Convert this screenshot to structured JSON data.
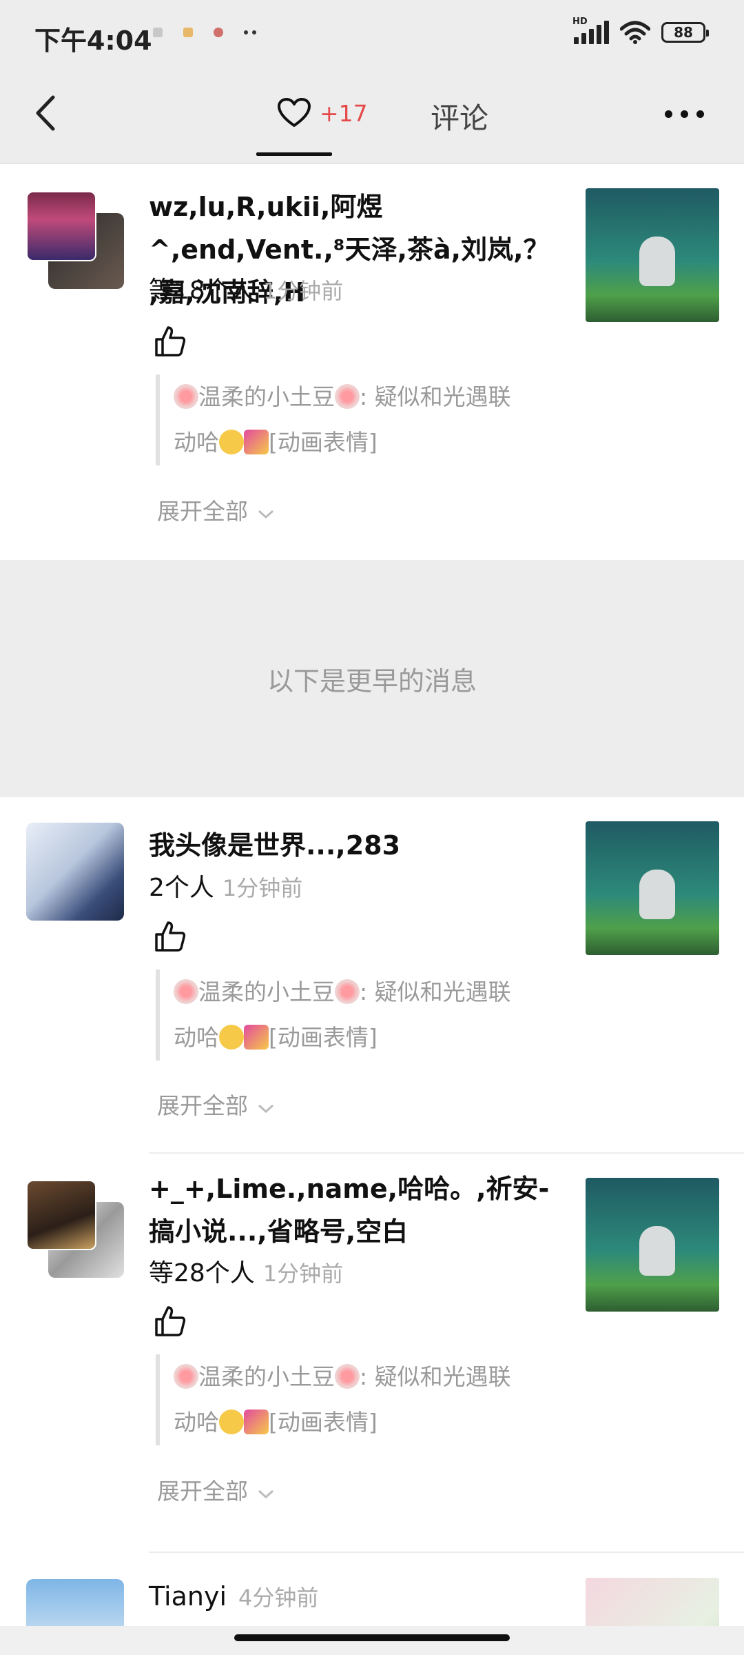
{
  "status_bar": {
    "time": "下午4:04",
    "network_badge": "HD",
    "battery": "88",
    "icons": [
      "signal-icon",
      "wifi-icon",
      "battery-icon"
    ]
  },
  "header": {
    "back_icon": "back-chevron-icon",
    "like_tab_count": "+17",
    "comment_tab_label": "评论",
    "more_icon": "more-dots-icon"
  },
  "items": [
    {
      "names": "wz,lu,R,ukii,阿煜^,end,Vent.,⁸天泽,茶à,刘岚,？ ,嘉,沈南辞,H",
      "count": "等18个人",
      "time": "1分钟前",
      "quote_line1_name": "温柔的小土豆",
      "quote_line1_rest": ": 疑似和光遇联",
      "quote_line2": "动哈",
      "quote_tag": "[动画表情]",
      "expand": "展开全部"
    },
    {
      "names": "我头像是世界...,283",
      "count": "2个人",
      "time": "1分钟前",
      "quote_line1_name": "温柔的小土豆",
      "quote_line1_rest": ": 疑似和光遇联",
      "quote_line2": "动哈",
      "quote_tag": "[动画表情]",
      "expand": "展开全部"
    },
    {
      "names": "+_+,Lime.,name,哈哈。,祈安-搞小说...,省略号,空白",
      "count": "等28个人",
      "time": "1分钟前",
      "quote_line1_name": "温柔的小土豆",
      "quote_line1_rest": ": 疑似和光遇联",
      "quote_line2": "动哈",
      "quote_tag": "[动画表情]",
      "expand": "展开全部"
    },
    {
      "names": "Tianyi",
      "time": "4分钟前"
    }
  ],
  "earlier_banner": "以下是更早的消息",
  "colors": {
    "accent_red": "#e5494a",
    "header_bg": "#ededed",
    "muted_text": "#9a9a9a"
  }
}
